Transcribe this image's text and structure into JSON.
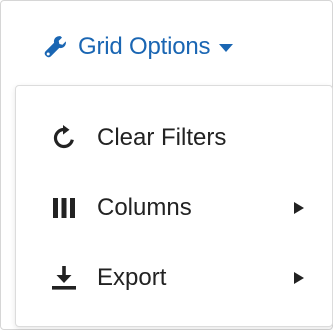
{
  "header": {
    "title": "Grid Options",
    "icon": "wrench-icon",
    "caret_icon": "caret-down-icon",
    "color": "#1a66b3"
  },
  "menu": {
    "items": [
      {
        "label": "Clear Filters",
        "icon": "refresh-icon",
        "submenu": false
      },
      {
        "label": "Columns",
        "icon": "columns-icon",
        "submenu": true
      },
      {
        "label": "Export",
        "icon": "download-icon",
        "submenu": true
      }
    ]
  }
}
